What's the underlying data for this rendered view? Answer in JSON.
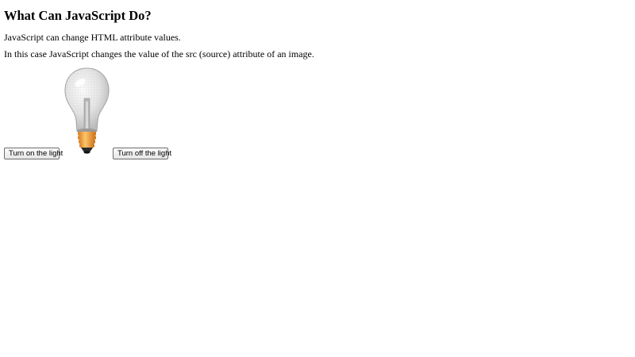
{
  "heading": "What Can JavaScript Do?",
  "paragraphs": {
    "p1": "JavaScript can change HTML attribute values.",
    "p2": "In this case JavaScript changes the value of the src (source) attribute of an image."
  },
  "buttons": {
    "on_label": "Turn on the light",
    "off_label": "Turn off the light"
  },
  "image": {
    "icon": "lightbulb-off-icon",
    "state": "off"
  },
  "colors": {
    "text": "#000000",
    "background": "#ffffff",
    "bulb_base": "#f0a040"
  }
}
